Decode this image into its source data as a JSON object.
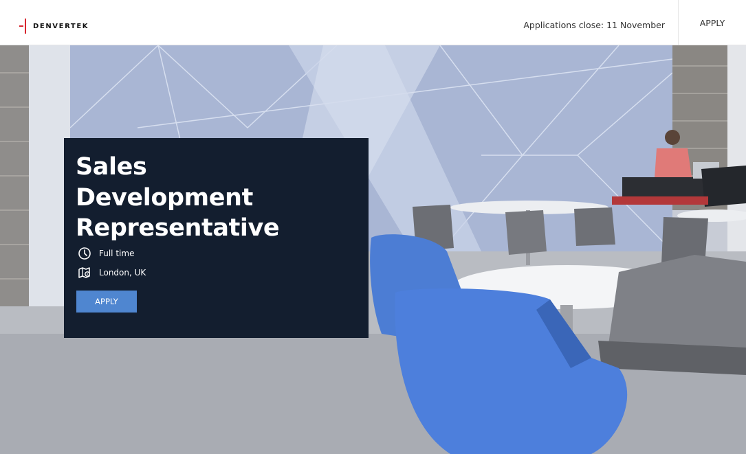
{
  "header": {
    "logo_text": "DENVERTEK",
    "applications_close": "Applications close: 11  November",
    "apply_label": "APPLY"
  },
  "job": {
    "title_line1": "Sales",
    "title_line2": "Development",
    "title_line3": "Representative",
    "employment_type": "Full time",
    "location": "London, UK",
    "apply_label": "APPLY"
  },
  "icons": {
    "clock": "clock-icon",
    "map": "map-pin-icon"
  },
  "colors": {
    "brand_red": "#d8262f",
    "card_bg": "#131e2f",
    "apply_button": "#4f86d0"
  }
}
